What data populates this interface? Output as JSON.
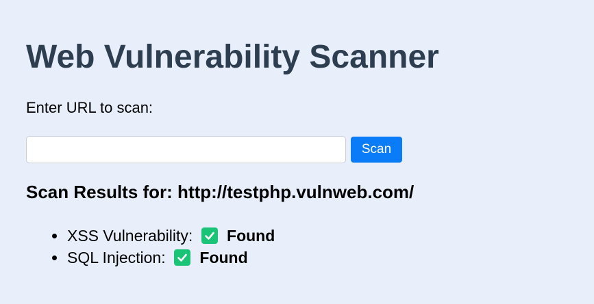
{
  "header": {
    "title": "Web Vulnerability Scanner"
  },
  "form": {
    "prompt": "Enter URL to scan:",
    "url_value": "",
    "url_placeholder": "",
    "scan_label": "Scan"
  },
  "results": {
    "heading": "Scan Results for: http://testphp.vulnweb.com/",
    "items": [
      {
        "label": "XSS Vulnerability:",
        "icon": "check-mark-icon",
        "status": "Found"
      },
      {
        "label": "SQL Injection:",
        "icon": "check-mark-icon",
        "status": "Found"
      }
    ]
  },
  "colors": {
    "background": "#e8effb",
    "title": "#2d3e50",
    "button": "#0b7cf8",
    "check": "#19c476"
  }
}
